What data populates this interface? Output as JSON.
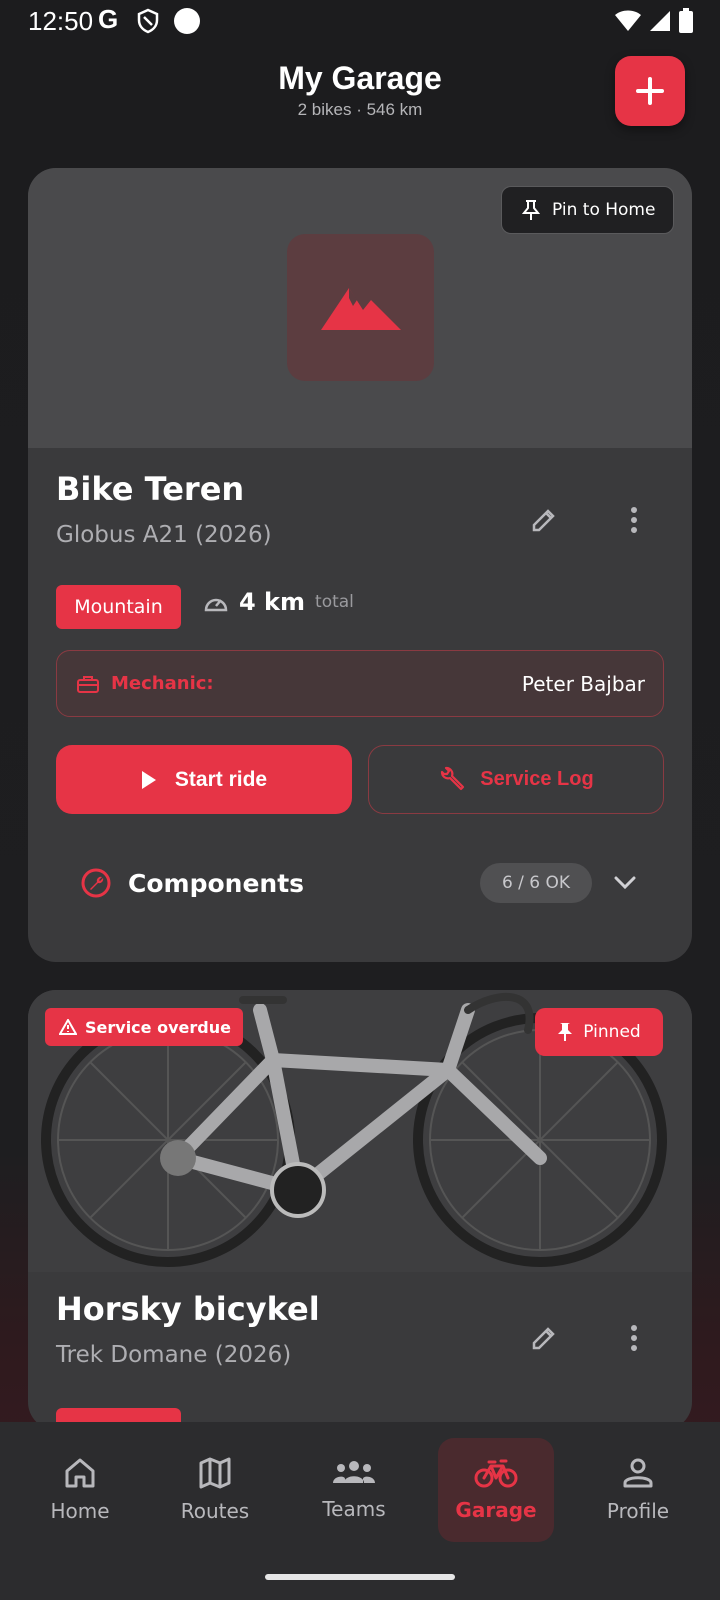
{
  "status_bar": {
    "time": "12:50",
    "g_label": "G"
  },
  "header": {
    "title": "My Garage",
    "subtitle": "2 bikes · 546 km"
  },
  "colors": {
    "accent": "#e63446",
    "background": "#1c1c1e",
    "card": "#3a3a3c"
  },
  "bikes": [
    {
      "pin_label": "Pin to Home",
      "name": "Bike Teren",
      "model": "Globus A21 (2026)",
      "type": "Mountain",
      "distance": "4 km",
      "distance_suffix": "total",
      "mechanic_label": "Mechanic:",
      "mechanic_name": "Peter Bajbar",
      "start_ride_label": "Start ride",
      "service_log_label": "Service Log",
      "components_label": "Components",
      "components_status": "6 / 6 OK"
    },
    {
      "overdue_label": "Service overdue",
      "pinned_label": "Pinned",
      "name": "Horsky bicykel",
      "model": "Trek Domane (2026)"
    }
  ],
  "nav": {
    "items": [
      {
        "label": "Home",
        "icon": "home-icon"
      },
      {
        "label": "Routes",
        "icon": "map-icon"
      },
      {
        "label": "Teams",
        "icon": "group-icon"
      },
      {
        "label": "Garage",
        "icon": "bike-icon",
        "active": true
      },
      {
        "label": "Profile",
        "icon": "person-icon"
      }
    ]
  }
}
